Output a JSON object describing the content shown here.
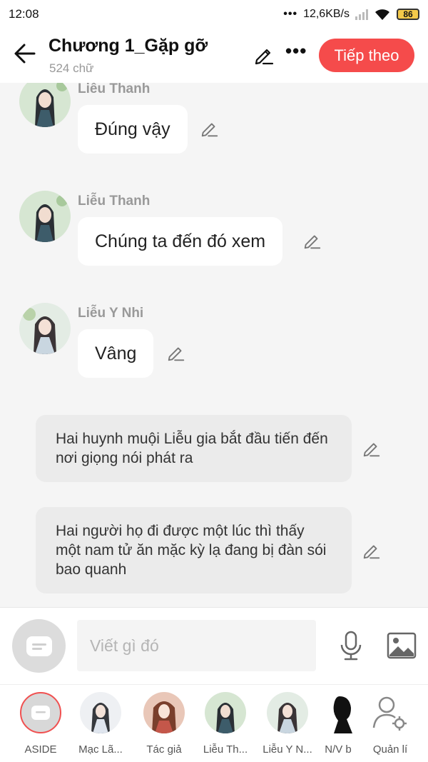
{
  "status_bar": {
    "time": "12:08",
    "network_speed": "12,6KB/s",
    "battery": "86"
  },
  "header": {
    "title": "Chương 1_Gặp gỡ",
    "subtitle": "524 chữ",
    "next_button": "Tiếp theo"
  },
  "messages": [
    {
      "sender": "Liễu Thanh",
      "text": "Đúng vậy"
    },
    {
      "sender": "Liễu Thanh",
      "text": "Chúng ta đến đó xem"
    },
    {
      "sender": "Liễu Y Nhi",
      "text": "Vâng"
    }
  ],
  "narrations": [
    "Hai huynh muội Liễu gia bắt đầu tiến đến nơi giọng nói phát ra",
    "Hai người họ đi được một lúc thì thấy một nam tử ăn mặc kỳ lạ đang bị đàn sói bao quanh"
  ],
  "composer": {
    "placeholder": "Viết gì đó"
  },
  "characters": [
    {
      "name": "ASIDE"
    },
    {
      "name": "Mạc Lã..."
    },
    {
      "name": "Tác giả"
    },
    {
      "name": "Liễu Th..."
    },
    {
      "name": "Liễu Y N..."
    },
    {
      "name": "N/V b"
    },
    {
      "name": "Quản lí"
    }
  ],
  "colors": {
    "accent": "#f54b4b",
    "background": "#f5f5f5",
    "narration_bg": "#ebebeb"
  }
}
